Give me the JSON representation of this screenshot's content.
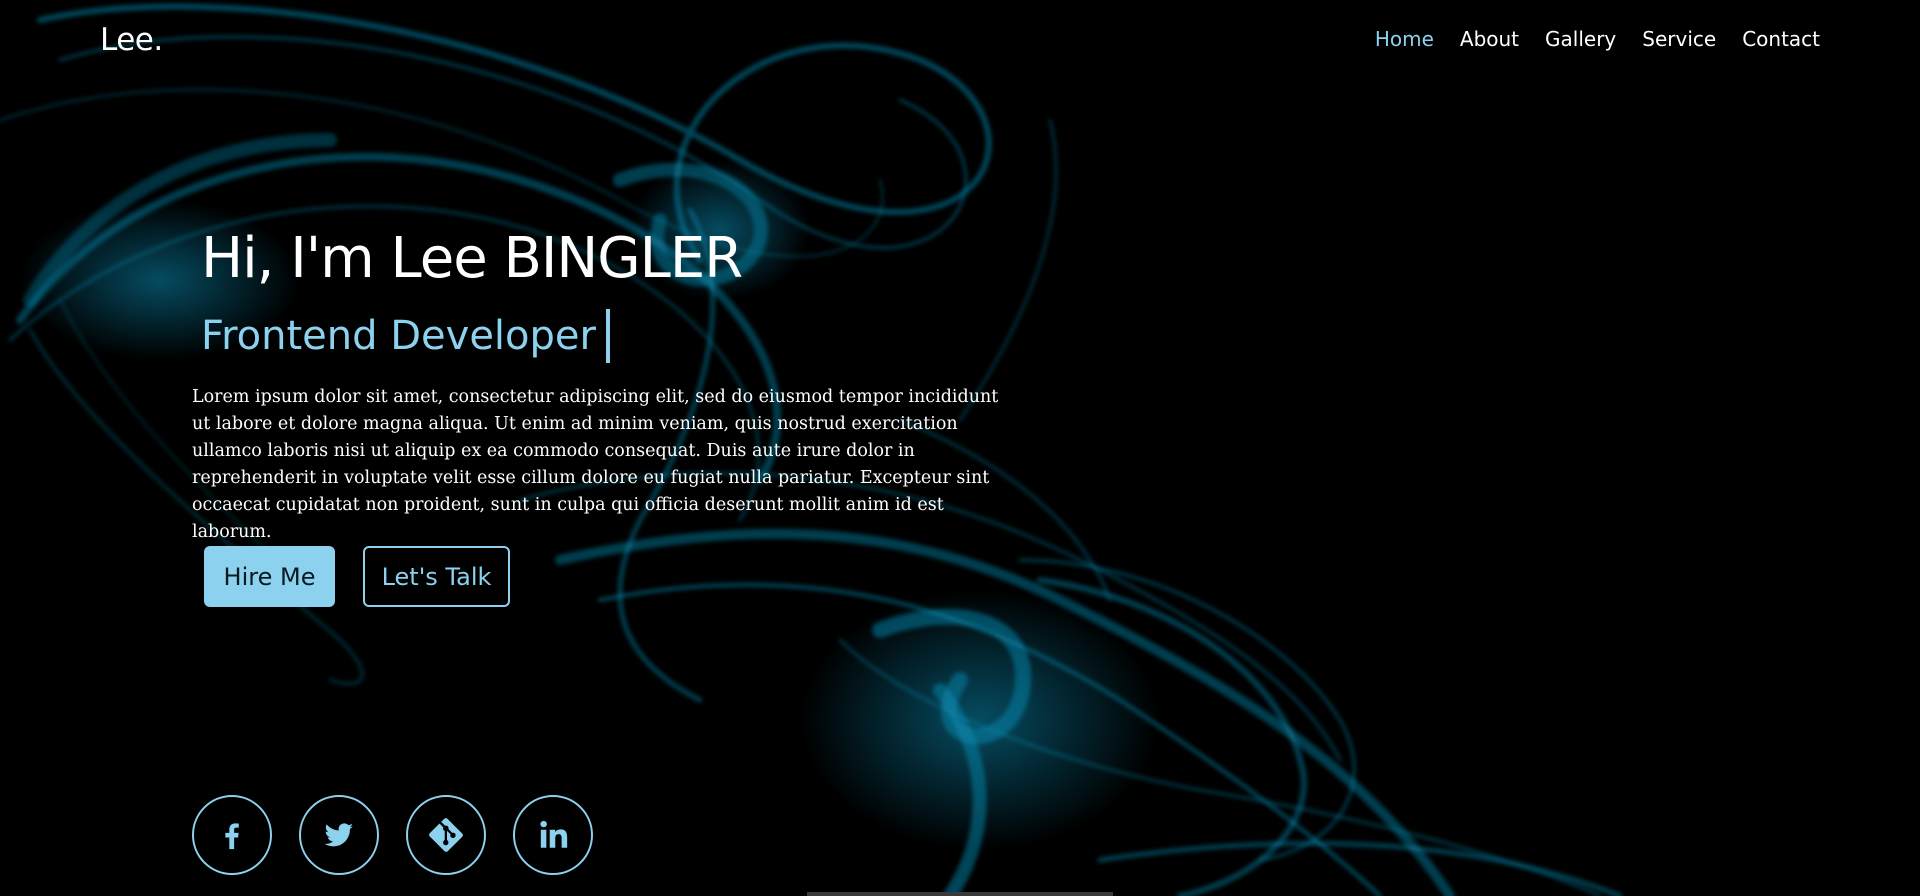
{
  "header": {
    "logo": "Lee.",
    "nav": [
      "Home",
      "About",
      "Gallery",
      "Service",
      "Contact"
    ]
  },
  "hero": {
    "greeting": "Hi, I'm Lee BINGLER",
    "role": "Frontend Developer",
    "bio": "Lorem ipsum dolor sit amet, consectetur adipiscing elit, sed do eiusmod tempor incididunt ut labore et dolore magna aliqua. Ut enim ad minim veniam, quis nostrud exercitation ullamco laboris nisi ut aliquip ex ea commodo consequat. Duis aute irure dolor in reprehenderit in voluptate velit esse cillum dolore eu fugiat nulla pariatur. Excepteur sint occaecat cupidatat non proident, sunt in culpa qui officia deserunt mollit anim id est laborum.",
    "hire_label": "Hire Me",
    "talk_label": "Let's Talk"
  },
  "social": {
    "icons": [
      "facebook-icon",
      "twitter-icon",
      "git-icon",
      "linkedin-icon"
    ]
  },
  "colors": {
    "accent": "#8cd1ee",
    "background": "#000000",
    "smoke": "#0a89b0"
  }
}
